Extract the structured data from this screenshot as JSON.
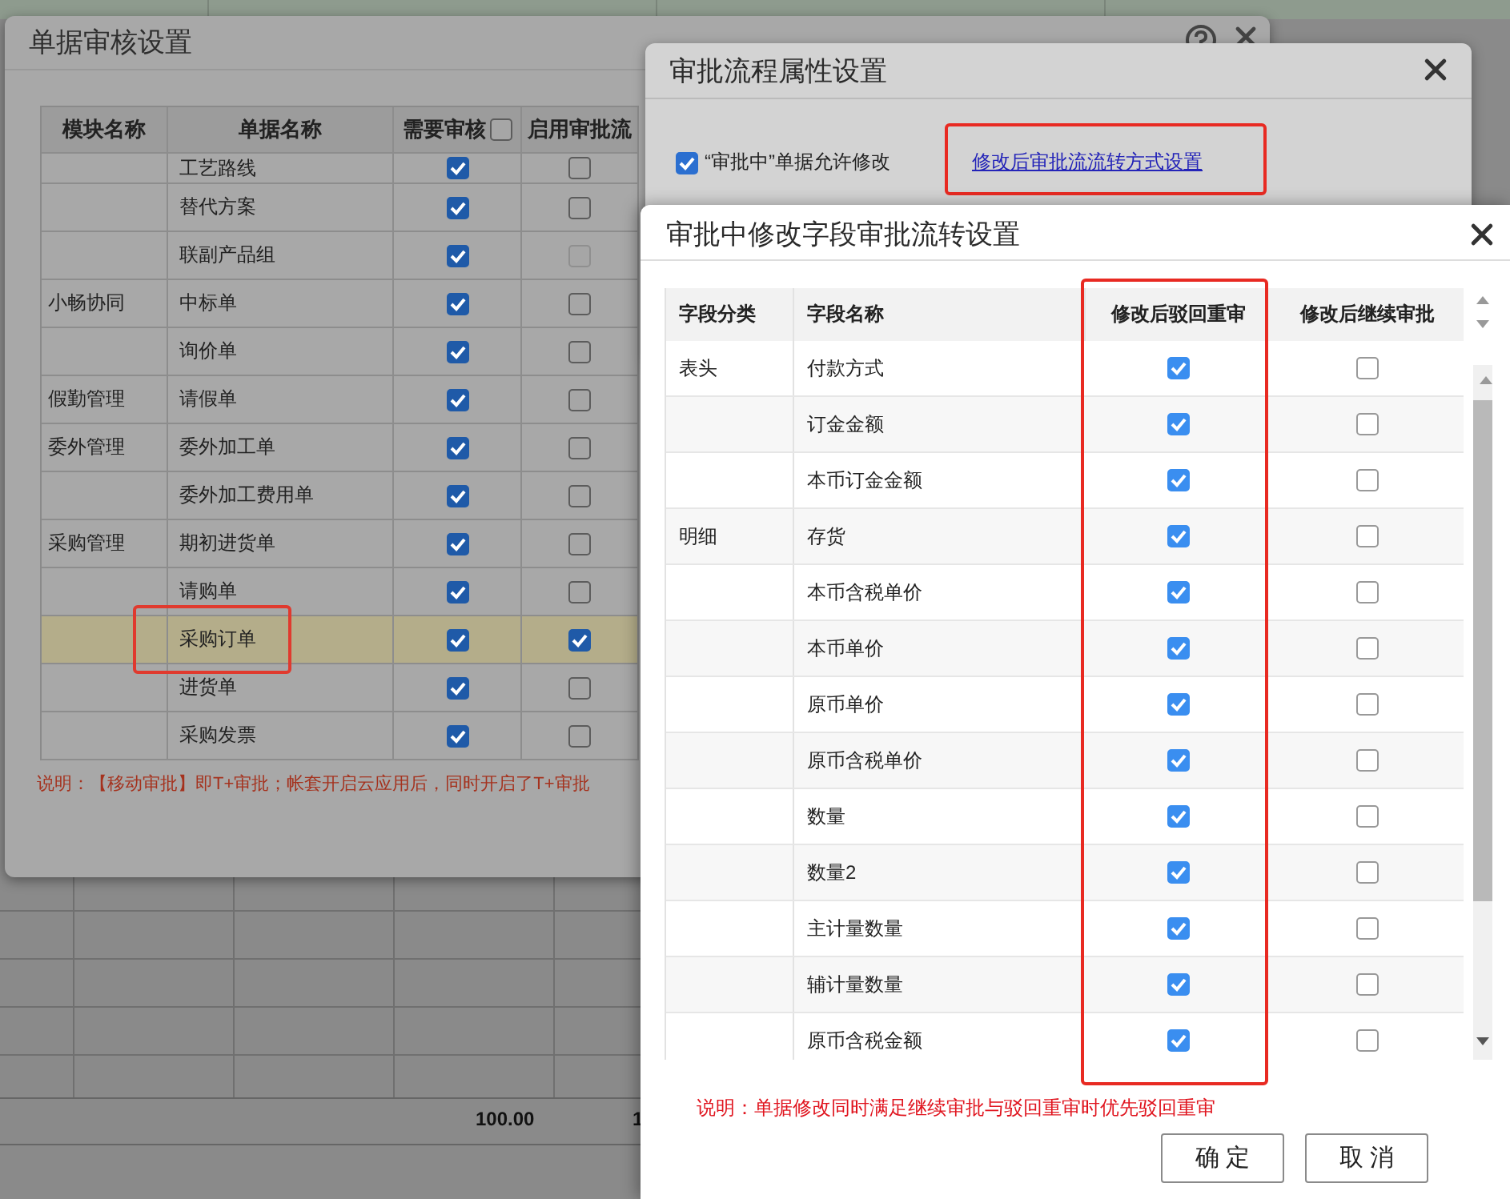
{
  "background_sheet": {
    "total_row": [
      "100.00",
      "1"
    ]
  },
  "audit_dialog": {
    "title": "单据审核设置",
    "columns": [
      "模块名称",
      "单据名称",
      "需要审核",
      "启用审批流"
    ],
    "header_checkbox_checked": false,
    "rows": [
      {
        "document": "工艺路线",
        "needs_audit": true,
        "approval_flow": false,
        "flow_disabled": false,
        "selected": false
      },
      {
        "document": "替代方案",
        "needs_audit": true,
        "approval_flow": false,
        "flow_disabled": false,
        "selected": false
      },
      {
        "document": "联副产品组",
        "needs_audit": true,
        "approval_flow": false,
        "flow_disabled": true,
        "selected": false
      },
      {
        "module": "小畅协同",
        "document": "中标单",
        "needs_audit": true,
        "approval_flow": false,
        "flow_disabled": false,
        "selected": false
      },
      {
        "document": "询价单",
        "needs_audit": true,
        "approval_flow": false,
        "flow_disabled": false,
        "selected": false
      },
      {
        "module": "假勤管理",
        "document": "请假单",
        "needs_audit": true,
        "approval_flow": false,
        "flow_disabled": false,
        "selected": false
      },
      {
        "module": "委外管理",
        "document": "委外加工单",
        "needs_audit": true,
        "approval_flow": false,
        "flow_disabled": false,
        "selected": false
      },
      {
        "document": "委外加工费用单",
        "needs_audit": true,
        "approval_flow": false,
        "flow_disabled": false,
        "selected": false
      },
      {
        "module": "采购管理",
        "document": "期初进货单",
        "needs_audit": true,
        "approval_flow": false,
        "flow_disabled": false,
        "selected": false
      },
      {
        "document": "请购单",
        "needs_audit": true,
        "approval_flow": false,
        "flow_disabled": false,
        "selected": false
      },
      {
        "document": "采购订单",
        "needs_audit": true,
        "approval_flow": true,
        "flow_disabled": false,
        "selected": true
      },
      {
        "document": "进货单",
        "needs_audit": true,
        "approval_flow": false,
        "flow_disabled": false,
        "selected": false
      },
      {
        "document": "采购发票",
        "needs_audit": true,
        "approval_flow": false,
        "flow_disabled": false,
        "selected": false
      }
    ],
    "note": "说明：【移动审批】即T+审批；帐套开启云应用后，同时开启了T+审批"
  },
  "process_dialog": {
    "title": "审批流程属性设置",
    "allow_edit": {
      "label": "“审批中”单据允许修改",
      "checked": true
    },
    "link": "修改后审批流流转方式设置"
  },
  "field_dialog": {
    "title": "审批中修改字段审批流转设置",
    "columns": [
      "字段分类",
      "字段名称",
      "修改后驳回重审",
      "修改后继续审批"
    ],
    "rows": [
      {
        "category": "表头",
        "field": "付款方式",
        "reject_review": true,
        "continue_approval": false
      },
      {
        "field": "订金金额",
        "reject_review": true,
        "continue_approval": false
      },
      {
        "field": "本币订金金额",
        "reject_review": true,
        "continue_approval": false
      },
      {
        "category": "明细",
        "field": "存货",
        "reject_review": true,
        "continue_approval": false
      },
      {
        "field": "本币含税单价",
        "reject_review": true,
        "continue_approval": false
      },
      {
        "field": "本币单价",
        "reject_review": true,
        "continue_approval": false
      },
      {
        "field": "原币单价",
        "reject_review": true,
        "continue_approval": false
      },
      {
        "field": "原币含税单价",
        "reject_review": true,
        "continue_approval": false
      },
      {
        "field": "数量",
        "reject_review": true,
        "continue_approval": false
      },
      {
        "field": "数量2",
        "reject_review": true,
        "continue_approval": false
      },
      {
        "field": "主计量数量",
        "reject_review": true,
        "continue_approval": false
      },
      {
        "field": "辅计量数量",
        "reject_review": true,
        "continue_approval": false
      },
      {
        "field": "原币含税金额",
        "reject_review": true,
        "continue_approval": false
      }
    ],
    "note": "说明：单据修改同时满足继续审批与驳回重审时优先驳回重审",
    "buttons": [
      "确 定",
      "取 消"
    ]
  }
}
